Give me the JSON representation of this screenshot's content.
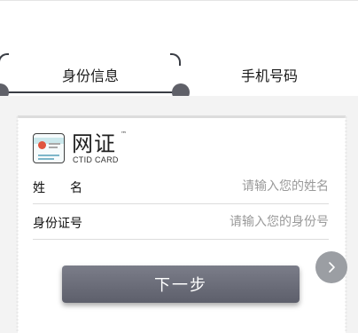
{
  "tabs": [
    {
      "label": "身份信息",
      "active": true
    },
    {
      "label": "手机号码",
      "active": false
    }
  ],
  "brand": {
    "title": "网证",
    "trademark": "™",
    "subtitle": "CTID CARD",
    "icon": "id-card-icon"
  },
  "form": {
    "fields": [
      {
        "label": "姓名",
        "value": "",
        "placeholder": "请输入您的姓名"
      },
      {
        "label": "身份证号",
        "value": "",
        "placeholder": "请输入您的身份号"
      }
    ]
  },
  "actions": {
    "next_label": "下一步",
    "side_icon": "chevron-right-icon"
  },
  "colors": {
    "accent_dark": "#3a3d45",
    "button": "#6b6d78",
    "background": "#f3f3f3",
    "placeholder": "#9a9a9a"
  }
}
